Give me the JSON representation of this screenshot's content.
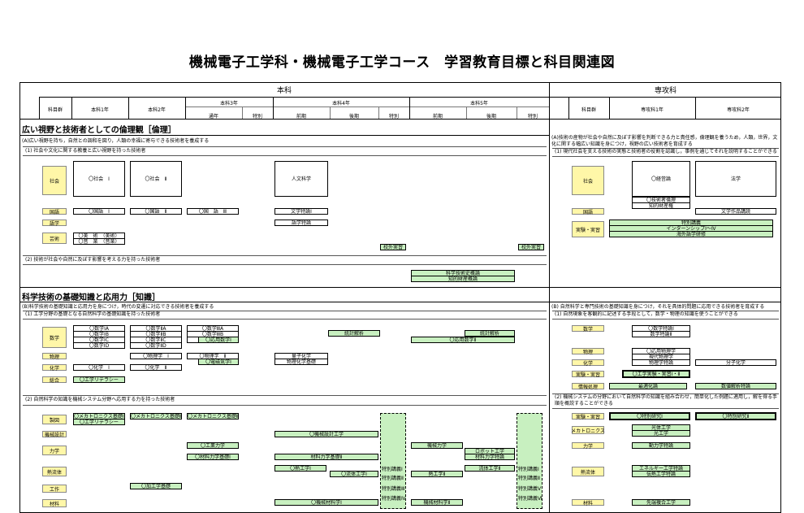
{
  "page_title": "機械電子工学科・機械電子工学コース　学習教育目標と科目関連図",
  "header": {
    "honka": "本科",
    "senkoka": "専攻科",
    "kamoku_gun": "科目群",
    "y1": "本科1年",
    "y2": "本科2年",
    "y3": "本科3年",
    "y4": "本科4年",
    "y5": "本科5年",
    "tsunen": "通年",
    "tokubetsu": "特別",
    "zenki": "前期",
    "kouki": "後期",
    "s1": "専攻科1年",
    "s2": "専攻科2年"
  },
  "sec1": {
    "title": "広い視野と技術者としての倫理観［倫理］",
    "goal_a": "(A)広い視野を持ち，自然との調和を図り，人類の幸福に寄与できる技術者を養成する",
    "goal_a1": "(1) 社会や文化に関する教養と広い視野を持った技術者",
    "goal_a2": "(2) 技術が社会や自然に及ぼす影響を考える力を持った技術者",
    "goal_r": "(A)技術の産物が社会や自然に及ぼす影響を判断できる力と責任感，倫理観を養うため，人類，世界，文化に関する幅広い知識を身につけ，視野の広い技術者を育成する",
    "goal_r1": "(1) 現代社会を支える技術の実態と技術者の役割を認識し，事例を通じてそれを説明することができる"
  },
  "sec2": {
    "title": "科学技術の基礎知識と応用力［知識］",
    "goal_b": "(B)科学技術の基礎知識と応用力を身につけ，時代の変遷に対応できる技術者を養成する",
    "goal_b1": "(1) 工学分野の基礎となる自然科学の基礎知識を持った技術者",
    "goal_b2": "(2) 自然科学の知識を機械システム分野へ応用する力を持った技術者",
    "goal_r": "(B) 自然科学と専門技術の基礎知識を身につけ，それを具体的問題に応用できる技術者を育成する",
    "goal_r1": "(1) 自然現象を客観的に記述する手段として，数学・物理の知識を使うことができる",
    "goal_r2": "(2) 機械システムの分野において自然科学の知識を組み合わせ，簡単化した例題に適用し，解を得る手順を概説することができる"
  },
  "cats": {
    "shakai": "社会",
    "kokugo": "国語",
    "gogaku": "語学",
    "geijutsu": "芸術",
    "sugaku": "数学",
    "butsuri": "物理",
    "kagaku": "化学",
    "sogo": "総合",
    "seisei": "製図",
    "kikai_sekkei": "機械設計",
    "rikigaku": "力学",
    "netsu": "熱流体",
    "kosaku": "工作",
    "zairyo": "材料",
    "jikken": "実験・実習",
    "joho": "情報処理",
    "mecha": "メカトロニクス"
  },
  "subjects": {
    "shakai1": "〇社会　Ⅰ",
    "shakai2": "〇社会　Ⅱ",
    "jinbun": "人文科学",
    "keieiron": "〇経営論",
    "hogaku": "法学",
    "gijutsusha_rinri": "〇技術者倫理",
    "chiteki_zaisan": "知的財産権",
    "kokugo1": "〇国語　Ⅰ",
    "kokugo2": "〇国語　Ⅱ",
    "kokugo3": "〇国　語　Ⅲ",
    "bungaku": "文学特論Ⅰ",
    "bunsaku": "文学作品講読",
    "gogaku": "語学特論",
    "bijutsu": "〇美　術　（美術）",
    "ongaku": "〇音　楽　（音楽）",
    "kougai1": "校外実習",
    "kougai2": "校外実習",
    "tokubetsu_kogi": "特別講義",
    "internship": "インターンシップⅠ～Ⅳ",
    "kaigai": "海外語学研修",
    "kagaku_gijutsu": "科学技術史概論",
    "chiteki_gairon": "知的財産概論",
    "m1a": "〇数学ⅠA",
    "m1b": "〇数学ⅠB",
    "m1c": "〇数学ⅠC",
    "m1d": "〇数学ⅠD",
    "m2a": "〇数学ⅡA",
    "m2b": "〇数学ⅡB",
    "m2c": "〇数学ⅡC",
    "m2d": "〇数学ⅡD",
    "m3a": "〇数学ⅢA",
    "m3b": "〇数学ⅢB",
    "m3c": "〇数学ⅢC",
    "oyo1": "〇応用数学Ⅰ",
    "tokei1": "統計解析",
    "tokei2": "統計解析",
    "oyo2": "〇応用数学Ⅱ",
    "sugaku_tokuron1": "〇数学特論Ⅰ",
    "sugaku_tokuron2": "数学特論Ⅱ",
    "butsuri1": "〇物理学　Ⅰ",
    "butsuri2": "〇物理学　Ⅱ",
    "denki": "〇電磁気学Ⅰ",
    "ryoshi": "量子化学",
    "butsuri_kagaku": "物理化学基礎",
    "oyo_butsuri": "〇応用物理学",
    "gendai_butsuri": "現代物理学",
    "butsuri_tokuron": "物理学特論",
    "kagaku1": "〇化学　Ⅰ",
    "kagaku2": "〇化学　Ⅱ",
    "seimei": "生命化学",
    "bunshi": "分子化学",
    "literacy": "〇工学リテラシー",
    "kogaku_jikken": "〇工学実験・実習Ⅰ・Ⅱ",
    "saiteki": "最適化論",
    "suchi": "数値解析特論",
    "mecha1": "〇メカトロニクス基礎Ⅰ(M)",
    "mecha2": "〇メカトロニクス基礎Ⅱ(M)",
    "mecha3": "〇メカトロニクス基礎Ⅲ(M)",
    "literacy2": "〇工学リテラシー",
    "kikai_sekkei": "〇機械設計工学",
    "tokubetsu_kenkyu1": "〇特別研究Ⅰ",
    "tokubetsu_kenkyu2": "〇特別研究Ⅱ",
    "koutai": "光体工学",
    "hikari": "光工学",
    "kogyo_rikigaku": "〇工業力学",
    "kikai_rikigaku": "機械力学",
    "robot": "ロボット工学",
    "doriki": "動力学特論",
    "zairyo_rikigaku1": "〇材料力学基礎Ⅰ",
    "zairyo_rikigaku2": "材料力学基礎Ⅱ",
    "zairyo_rikigaku3": "材料力学特論",
    "netsu1": "〇熱工学Ⅰ",
    "ryutai1": "〇流体工学Ⅰ",
    "netsu2": "熱工学Ⅱ",
    "ryutai2": "流体工学Ⅱ",
    "energy": "エネルギー工学特論",
    "dennetsu": "伝熱工学特論",
    "kako": "〇加工学基礎",
    "kikai_zairyo": "〇機械材料学Ⅰ",
    "kikai_zairyo2": "機械材料学Ⅱ",
    "sentan": "先端複合工学",
    "tk1": "特別講義Ⅰ",
    "tk2": "特別講義Ⅱ",
    "tk3": "特別講義Ⅲ",
    "tk4": "特別講義Ⅳ",
    "tk5": "特別講義Ⅴ",
    "tk6": "特別講義Ⅵ"
  }
}
